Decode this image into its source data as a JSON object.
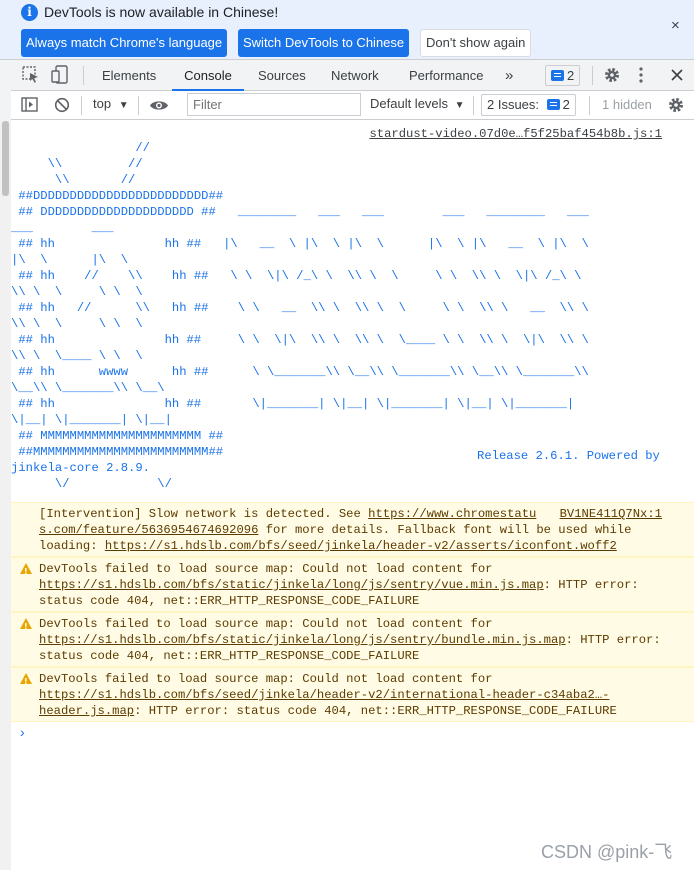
{
  "infobar": {
    "message": "DevTools is now available in Chinese!",
    "buttons": [
      "Always match Chrome's language",
      "Switch DevTools to Chinese",
      "Don't show again"
    ],
    "close": "×"
  },
  "tabs": {
    "items": [
      "Elements",
      "Console",
      "Sources",
      "Network",
      "Performance"
    ],
    "more": "»",
    "active": "Console",
    "issues_count": "2"
  },
  "toolbar": {
    "context": "top",
    "filter_placeholder": "Filter",
    "levels": "Default levels",
    "issues_label": "2 Issues:",
    "issues_count": "2",
    "hidden": "1 hidden"
  },
  "console": {
    "source_link": "stardust-video.07d0e…f5f25baf454b8b.js:1",
    "ascii_art": "                 //\n     \\\\         //\n      \\\\       //\n ##DDDDDDDDDDDDDDDDDDDDDDDD##\n ## DDDDDDDDDDDDDDDDDDDDD ##   ________   ___   ___        ___   ________   ___\n___        ___\n ## hh               hh ##   |\\   __  \\ |\\  \\ |\\  \\      |\\  \\ |\\   __  \\ |\\  \\\n|\\  \\      |\\  \\\n ## hh    //    \\\\    hh ##   \\ \\  \\|\\ /_\\ \\  \\\\ \\  \\     \\ \\  \\\\ \\  \\|\\ /_\\ \\\n\\\\ \\  \\     \\ \\  \\\n ## hh   //      \\\\   hh ##    \\ \\   __  \\\\ \\  \\\\ \\  \\     \\ \\  \\\\ \\   __  \\\\ \\\n\\\\ \\  \\     \\ \\  \\\n ## hh               hh ##     \\ \\  \\|\\  \\\\ \\  \\\\ \\  \\____ \\ \\  \\\\ \\  \\|\\  \\\\ \\\n\\\\ \\  \\____ \\ \\  \\\n ## hh      wwww      hh ##      \\ \\_______\\\\ \\__\\\\ \\_______\\\\ \\__\\\\ \\_______\\\\\n\\__\\\\ \\_______\\\\ \\__\\\n ## hh               hh ##       \\|_______| \\|__| \\|_______| \\|__| \\|_______|\n\\|__| \\|_______| \\|__|\n ## MMMMMMMMMMMMMMMMMMMMMM ##\n ##MMMMMMMMMMMMMMMMMMMMMMMM##\njinkela-core 2.8.9.\n      \\/            \\/",
    "release": "Release 2.6.1. Powered by",
    "messages": [
      {
        "type": "intervention",
        "text1": "[Intervention] Slow network is detected. See ",
        "link1": "https://www.chromestatu",
        "source": "BV1NE411Q7Nx:1",
        "link1b": "s.com/feature/5636954674692096",
        "text2": " for more details. Fallback font will be used while loading: ",
        "link2": "https://s1.hdslb.com/bfs/seed/jinkela/header-v2/asserts/iconfont.woff2"
      },
      {
        "type": "warning",
        "text1": "DevTools failed to load source map: Could not load content for ",
        "link1": "https://s1.hdslb.com/bfs/static/jinkela/long/js/sentry/vue.min.js.map",
        "text2": ": HTTP error: status code 404, net::ERR_HTTP_RESPONSE_CODE_FAILURE"
      },
      {
        "type": "warning",
        "text1": "DevTools failed to load source map: Could not load content for ",
        "link1": "https://s1.hdslb.com/bfs/static/jinkela/long/js/sentry/bundle.min.js.map",
        "text2": ": HTTP error: status code 404, net::ERR_HTTP_RESPONSE_CODE_FAILURE"
      },
      {
        "type": "warning",
        "text1": "DevTools failed to load source map: Could not load content for ",
        "link1": "https://s1.hdslb.com/bfs/seed/jinkela/header-v2/international-header-c34aba2…-header.js.map",
        "text2": ": HTTP error: status code 404, net::ERR_HTTP_RESPONSE_CODE_FAILURE"
      }
    ],
    "prompt": "›"
  },
  "watermark": "CSDN @pink-飞",
  "colors": {
    "accent": "#1a73e8",
    "warning_bg": "#fffbe5",
    "warning_text": "#5c3c00"
  }
}
